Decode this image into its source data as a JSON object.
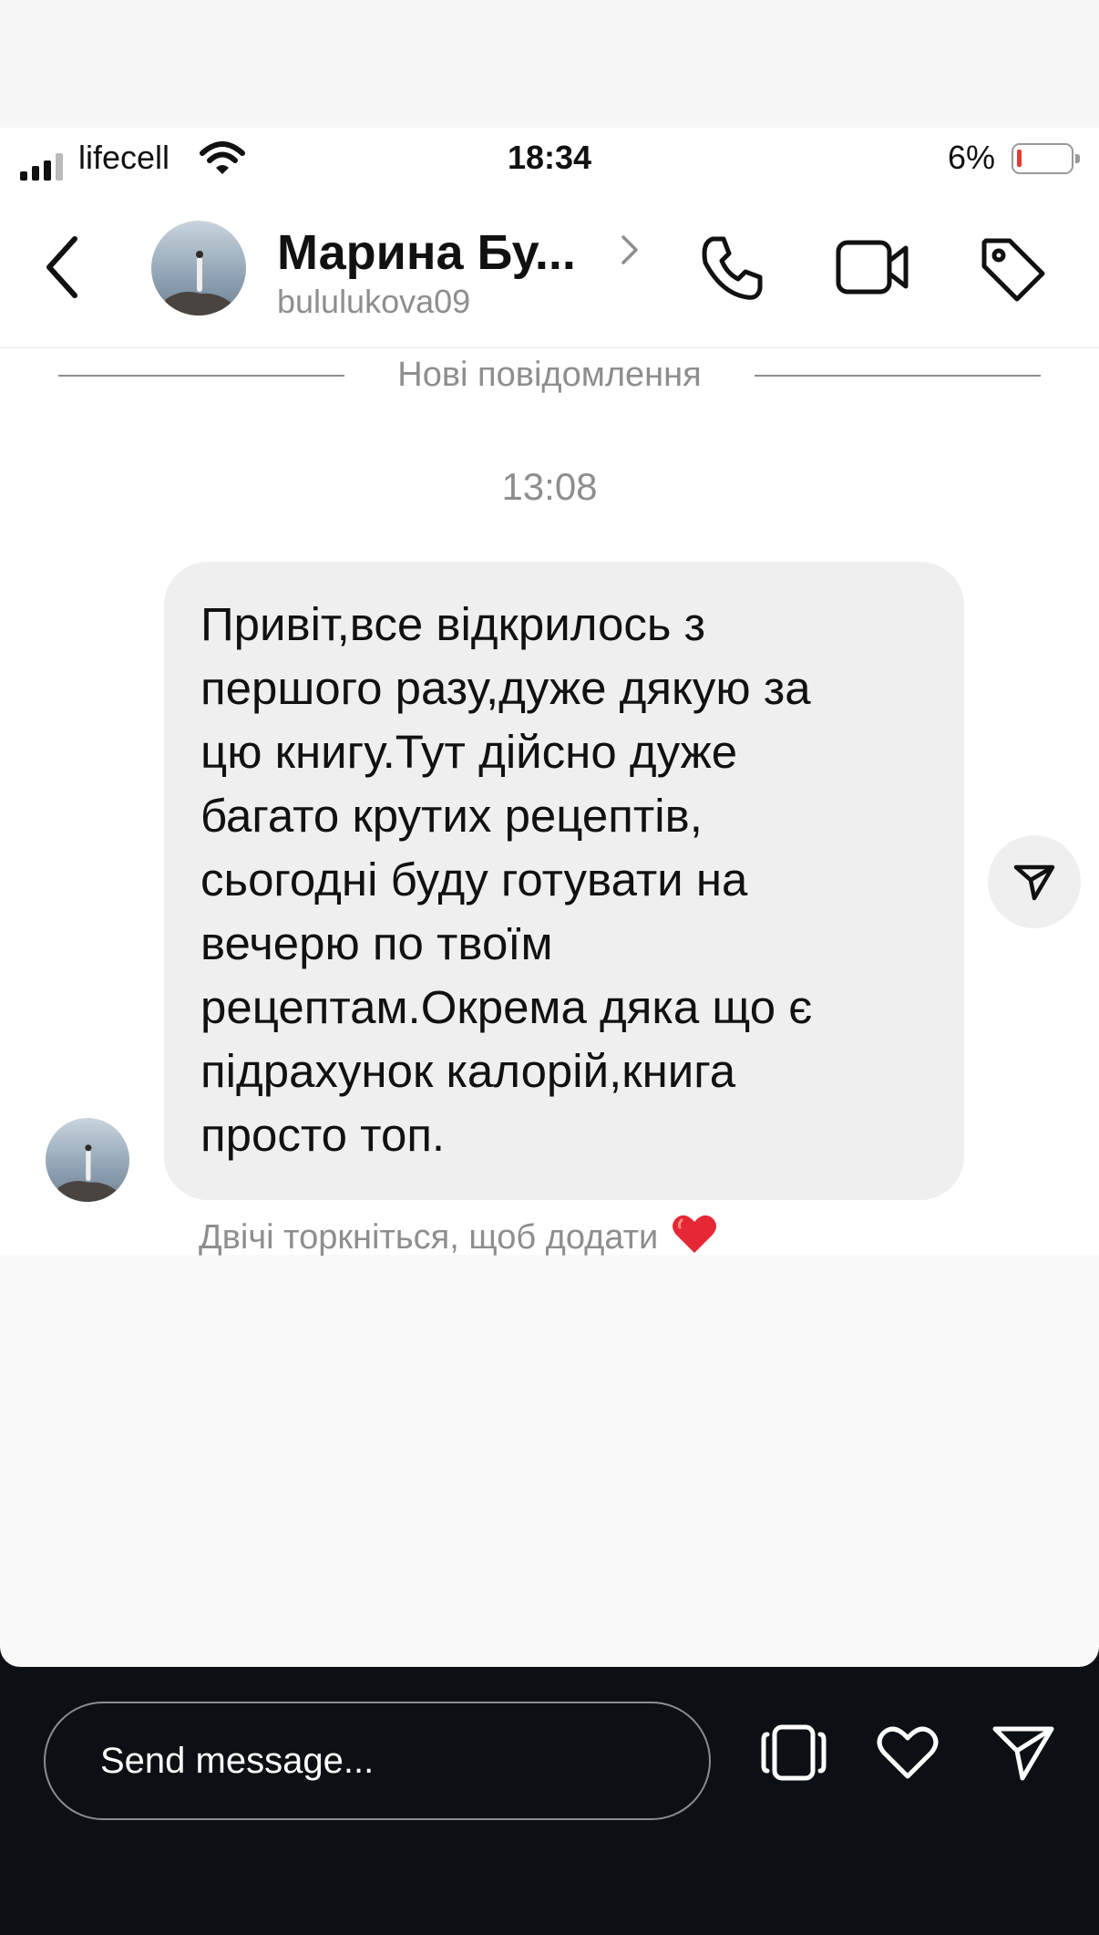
{
  "status_bar": {
    "carrier": "lifecell",
    "time": "18:34",
    "battery_percent": "6%",
    "battery_level": 0.06,
    "battery_color": "#e53935"
  },
  "header": {
    "contact_name": "Марина Бу...",
    "username": "bululukova09"
  },
  "divider": {
    "label": "Нові повідомлення"
  },
  "conversation": {
    "timestamp": "13:08",
    "message": "Привіт,все відкрилось з\nпершого разу,дуже дякую за\nцю книгу.Тут дійсно дуже\nбагато крутих рецептів,\nсьогодні буду готувати на\nвечерю по твоїм\nрецептам.Окрема дяка що є\nпідрахунок калорій,книга\nпросто топ.",
    "double_tap_hint": "Двічі торкніться, щоб додати",
    "reaction_icon": "red-heart"
  },
  "story_reply": {
    "placeholder": "Send message..."
  },
  "icons": [
    "back-chevron-icon",
    "phone-icon",
    "video-camera-icon",
    "tag-icon",
    "share-icon",
    "sticker-icon",
    "heart-icon",
    "send-icon"
  ]
}
